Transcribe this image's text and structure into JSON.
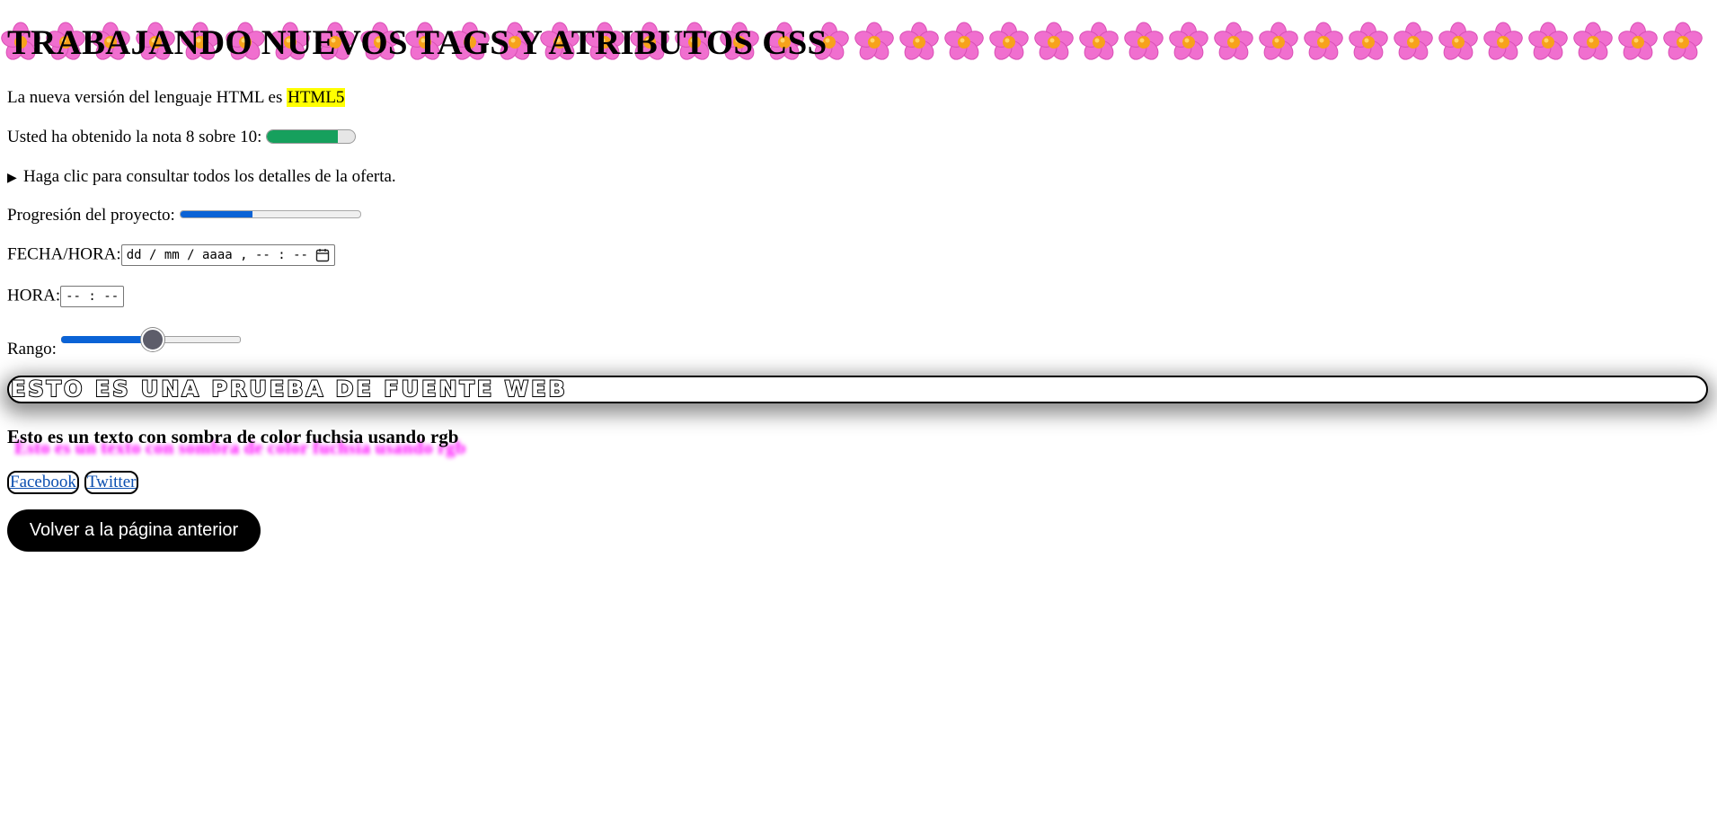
{
  "header": {
    "title": "TRABAJANDO NUEVOS TAGS Y ATRIBUTOS CSS",
    "decoration_icon": "flower-icon"
  },
  "mark_line": {
    "text": "La nueva versión del lenguaje HTML es ",
    "highlight": "HTML5",
    "highlight_color": "#ffff00"
  },
  "meter_line": {
    "label": "Usted ha obtenido la nota 8 sobre 10:",
    "value": 8,
    "max": 10,
    "fill_color": "#16a05d"
  },
  "details": {
    "summary": "Haga clic para consultar todos los detalles de la oferta."
  },
  "progress_line": {
    "label": "Progresión del proyecto:",
    "value": 0.4,
    "fill_color": "#0b63d6"
  },
  "datetime_field": {
    "label": "FECHA/HORA:",
    "placeholder": "dd / mm / aaaa ,  -- : --"
  },
  "time_field": {
    "label": "HORA:",
    "placeholder": "-- : --"
  },
  "range_field": {
    "label": "Rango:",
    "value": 0.5
  },
  "webfont_text": "ESTO ES UNA PRUEBA DE FUENTE WEB",
  "shadow_text": {
    "text": "Esto es un texto con sombra de color fuchsia usando rgb",
    "shadow_color": "rgb(255, 0, 255)"
  },
  "links": [
    "Facebook",
    "Twitter"
  ],
  "back_button": "Volver a la página anterior"
}
